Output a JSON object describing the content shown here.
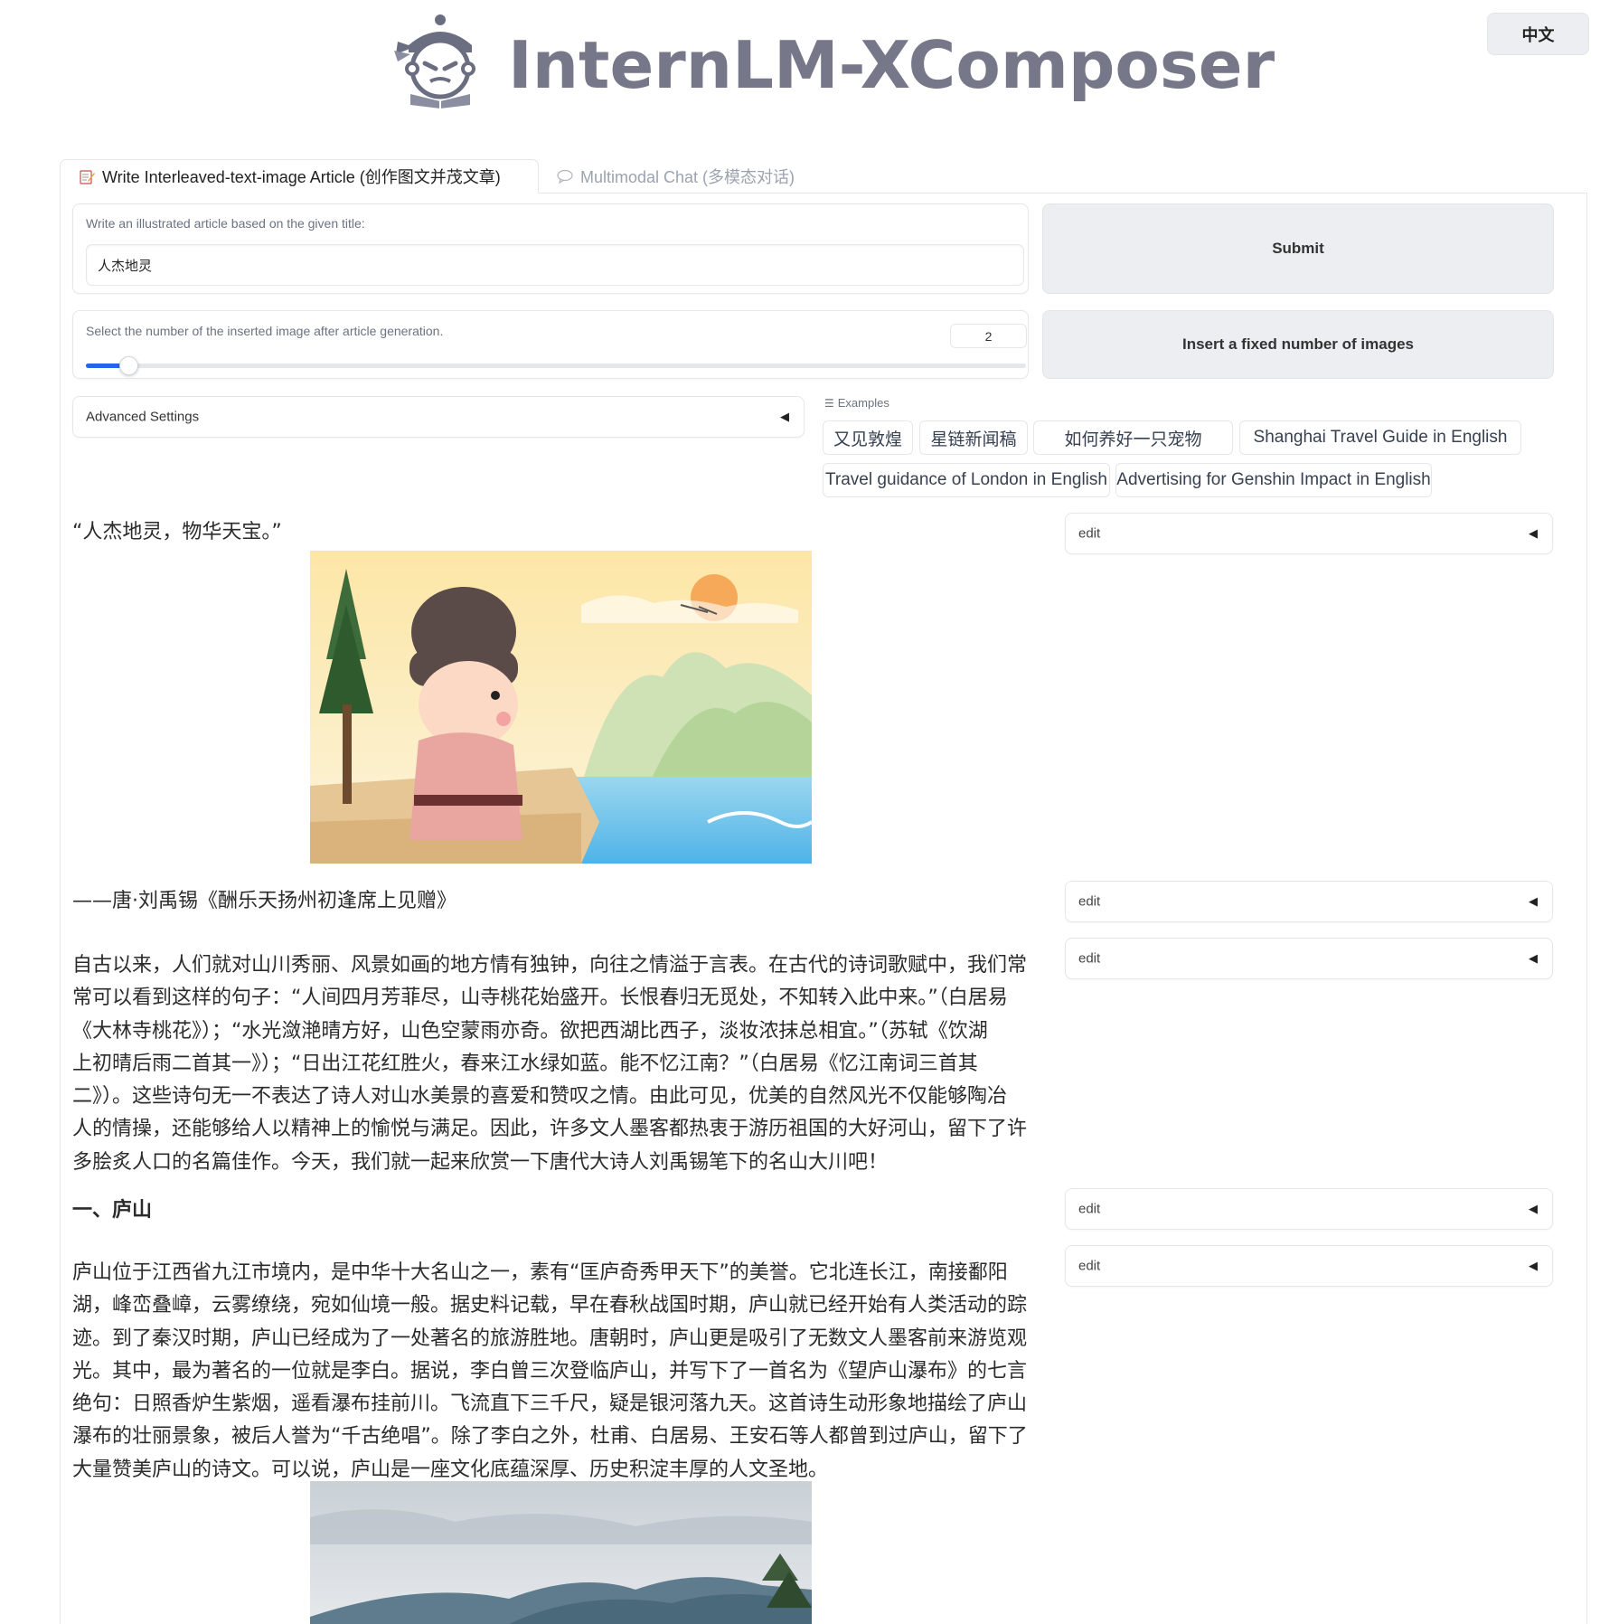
{
  "header": {
    "app_title": "InternLM-XComposer",
    "language_button": "中文"
  },
  "tabs": [
    {
      "label": "Write Interleaved-text-image Article (创作图文并茂文章)",
      "icon": "pencil-icon",
      "active": true
    },
    {
      "label": "Multimodal Chat (多模态对话)",
      "icon": "chat-bubble-icon",
      "active": false
    }
  ],
  "title_input": {
    "label": "Write an illustrated article based on the given title:",
    "value": "人杰地灵"
  },
  "submit_button": "Submit",
  "image_count": {
    "label": "Select the number of the inserted image after article generation.",
    "value": "2",
    "fraction": 0.045
  },
  "insert_button": "Insert a fixed number of images",
  "advanced_settings": "Advanced Settings",
  "examples": {
    "label": "Examples",
    "items": [
      "又见敦煌",
      "星链新闻稿",
      "如何养好一只宠物",
      "Shanghai Travel Guide in English",
      "Travel guidance of London in English",
      "Advertising for Genshin Impact in English"
    ]
  },
  "article": {
    "quote": "“人杰地灵，物华天宝。”",
    "attribution": "——唐·刘禹锡《酬乐天扬州初逢席上见赠》",
    "intro_lines": [
      "自古以来，人们就对山川秀丽、风景如画的地方情有独钟，向往之情溢于言表。在古代的诗词歌赋中，我们常",
      "常可以看到这样的句子：“人间四月芳菲尽，山寺桃花始盛开。长恨春归无觅处，不知转入此中来。”（白居易",
      "《大林寺桃花》）；“水光潋滟晴方好，山色空蒙雨亦奇。欲把西湖比西子，淡妆浓抹总相宜。”（苏轼《饮湖",
      "上初晴后雨二首其一》）；“日出江花红胜火，春来江水绿如蓝。能不忆江南？”（白居易《忆江南词三首其",
      "二》）。这些诗句无一不表达了诗人对山水美景的喜爱和赞叹之情。由此可见，优美的自然风光不仅能够陶冶",
      "人的情操，还能够给人以精神上的愉悦与满足。因此，许多文人墨客都热衷于游历祖国的大好河山，留下了许",
      "多脍炙人口的名篇佳作。今天，我们就一起来欣赏一下唐代大诗人刘禹锡笔下的名山大川吧！"
    ],
    "section_heading": "一、庐山",
    "lushan_lines": [
      "庐山位于江西省九江市境内，是中华十大名山之一，素有“匡庐奇秀甲天下”的美誉。它北连长江，南接鄱阳",
      "湖，峰峦叠嶂，云雾缭绕，宛如仙境一般。据史料记载，早在春秋战国时期，庐山就已经开始有人类活动的踪",
      "迹。到了秦汉时期，庐山已经成为了一处著名的旅游胜地。唐朝时，庐山更是吸引了无数文人墨客前来游览观",
      "光。其中，最为著名的一位就是李白。据说，李白曾三次登临庐山，并写下了一首名为《望庐山瀑布》的七言",
      "绝句：日照香炉生紫烟，遥看瀑布挂前川。飞流直下三千尺，疑是银河落九天。这首诗生动形象地描绘了庐山",
      "瀑布的壮丽景象，被后人誉为“千古绝唱”。除了李白之外，杜甫、白居易、王安石等人都曾到过庐山，留下了",
      "大量赞美庐山的诗文。可以说，庐山是一座文化底蕴深厚、历史积淀丰厚的人文圣地。"
    ]
  },
  "edit_label": "edit",
  "colors": {
    "accent": "#2563eb",
    "title_gray": "#767889",
    "button_bg": "#eceef1"
  }
}
